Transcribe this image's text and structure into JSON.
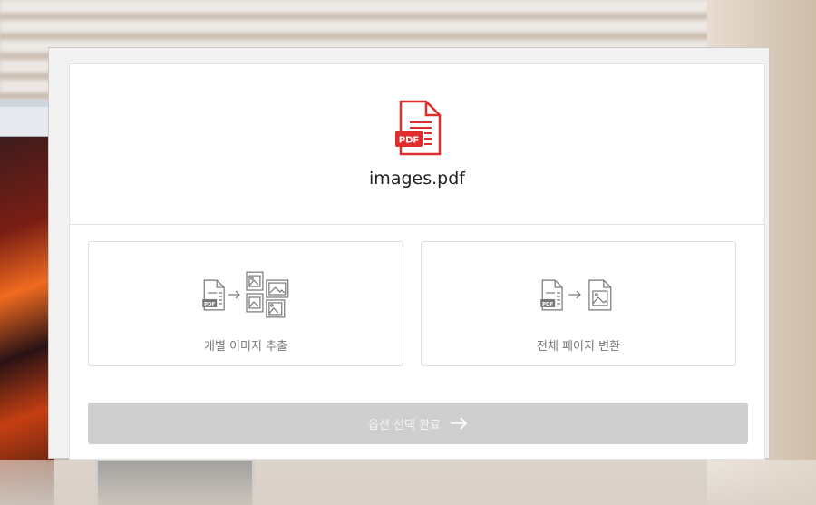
{
  "file": {
    "name": "images.pdf",
    "type_badge": "PDF"
  },
  "options": [
    {
      "label": "개별 이미지 추출",
      "icon": "pdf-to-multiple-images-icon"
    },
    {
      "label": "전체 페이지 변환",
      "icon": "pdf-to-single-image-icon"
    }
  ],
  "submit": {
    "label": "옵션 선택 완료",
    "icon": "arrow-right-icon"
  },
  "colors": {
    "accent": "#e02d2d",
    "disabled": "#cfcfcf"
  }
}
